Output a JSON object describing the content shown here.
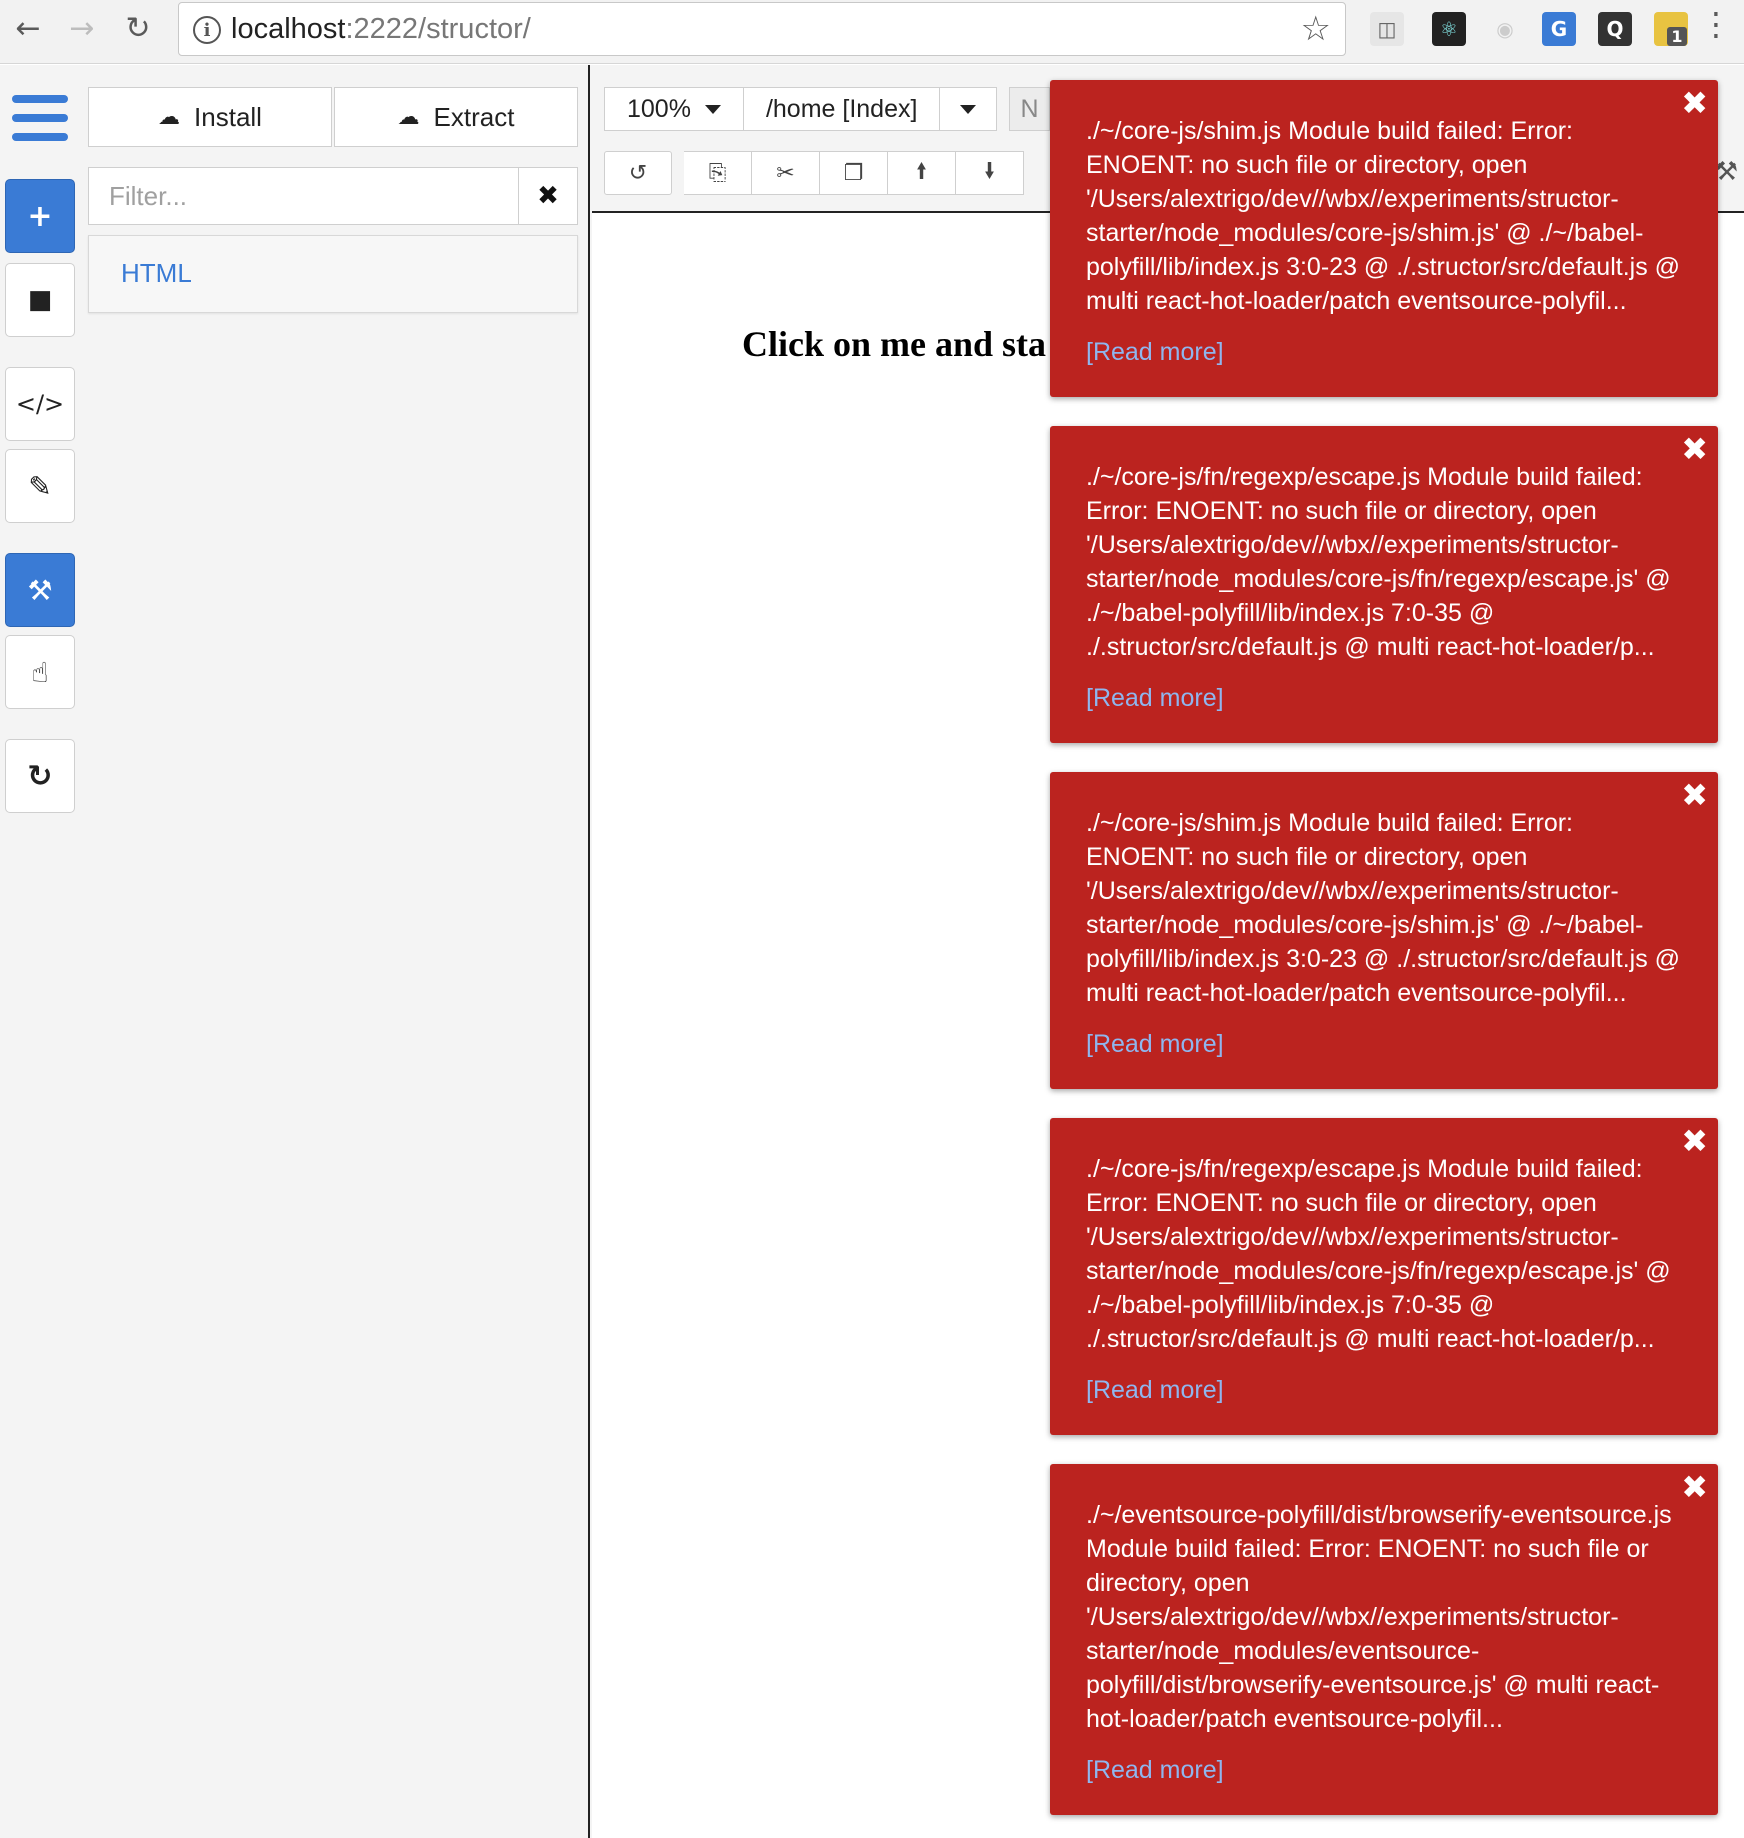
{
  "browser": {
    "url_host": "localhost",
    "url_path": ":2222/structor/",
    "back_icon": "back-arrow-icon",
    "forward_icon": "forward-arrow-icon",
    "reload_icon": "reload-icon",
    "bookmark_icon": "star-icon",
    "extension_badge": "1"
  },
  "sidebar": {
    "install_label": "Install",
    "extract_label": "Extract",
    "filter_placeholder": "Filter...",
    "list_items": [
      "HTML"
    ]
  },
  "toolbar": {
    "zoom": "100%",
    "page": "/home [Index]",
    "truncated_label": "N"
  },
  "canvas": {
    "text": "Click on me and sta"
  },
  "colors": {
    "accent": "#3a7bd5",
    "error_bg": "#bb231f",
    "link": "#8fb6ee"
  },
  "notifications": [
    {
      "message": "./~/core-js/shim.js Module build failed: Error: ENOENT: no such file or directory, open '/Users/alextrigo/dev//wbx//experiments/structor-starter/node_modules/core-js/shim.js' @ ./~/babel-polyfill/lib/index.js 3:0-23 @ ./.structor/src/default.js @ multi react-hot-loader/patch eventsource-polyfil...",
      "link": "[Read more]"
    },
    {
      "message": "./~/core-js/fn/regexp/escape.js Module build failed: Error: ENOENT: no such file or directory, open '/Users/alextrigo/dev//wbx//experiments/structor-starter/node_modules/core-js/fn/regexp/escape.js' @ ./~/babel-polyfill/lib/index.js 7:0-35 @ ./.structor/src/default.js @ multi react-hot-loader/p...",
      "link": "[Read more]"
    },
    {
      "message": "./~/core-js/shim.js Module build failed: Error: ENOENT: no such file or directory, open '/Users/alextrigo/dev//wbx//experiments/structor-starter/node_modules/core-js/shim.js' @ ./~/babel-polyfill/lib/index.js 3:0-23 @ ./.structor/src/default.js @ multi react-hot-loader/patch eventsource-polyfil...",
      "link": "[Read more]"
    },
    {
      "message": "./~/core-js/fn/regexp/escape.js Module build failed: Error: ENOENT: no such file or directory, open '/Users/alextrigo/dev//wbx//experiments/structor-starter/node_modules/core-js/fn/regexp/escape.js' @ ./~/babel-polyfill/lib/index.js 7:0-35 @ ./.structor/src/default.js @ multi react-hot-loader/p...",
      "link": "[Read more]"
    },
    {
      "message": "./~/eventsource-polyfill/dist/browserify-eventsource.js Module build failed: Error: ENOENT: no such file or directory, open '/Users/alextrigo/dev//wbx//experiments/structor-starter/node_modules/eventsource-polyfill/dist/browserify-eventsource.js' @ multi react-hot-loader/patch eventsource-polyfil...",
      "link": "[Read more]"
    }
  ]
}
